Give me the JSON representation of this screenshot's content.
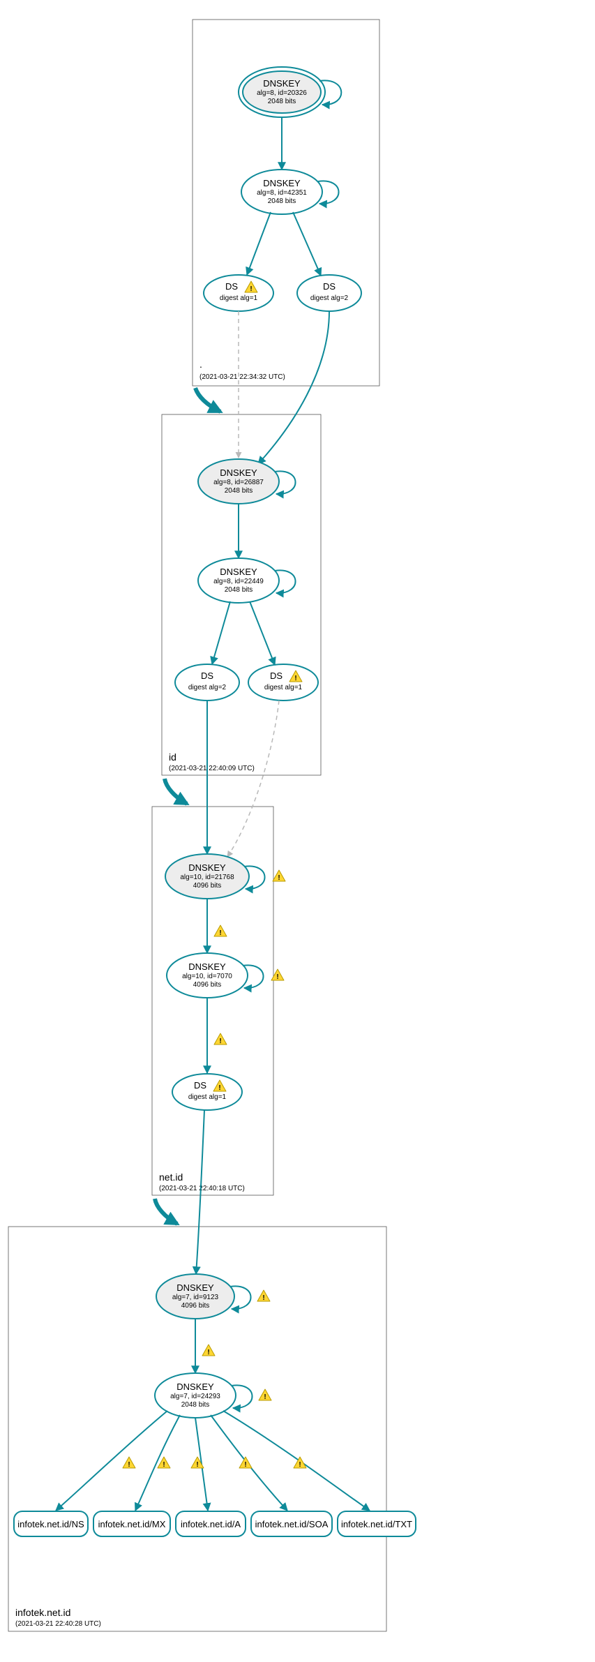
{
  "zones": {
    "root": {
      "label": ".",
      "timestamp": "(2021-03-21 22:34:32 UTC)"
    },
    "id": {
      "label": "id",
      "timestamp": "(2021-03-21 22:40:09 UTC)"
    },
    "netid": {
      "label": "net.id",
      "timestamp": "(2021-03-21 22:40:18 UTC)"
    },
    "target": {
      "label": "infotek.net.id",
      "timestamp": "(2021-03-21 22:40:28 UTC)"
    }
  },
  "nodes": {
    "root_ksk": {
      "title": "DNSKEY",
      "alg": "alg=8, id=20326",
      "bits": "2048 bits"
    },
    "root_zsk": {
      "title": "DNSKEY",
      "alg": "alg=8, id=42351",
      "bits": "2048 bits"
    },
    "root_ds1": {
      "title": "DS",
      "sub": "digest alg=1"
    },
    "root_ds2": {
      "title": "DS",
      "sub": "digest alg=2"
    },
    "id_ksk": {
      "title": "DNSKEY",
      "alg": "alg=8, id=26887",
      "bits": "2048 bits"
    },
    "id_zsk": {
      "title": "DNSKEY",
      "alg": "alg=8, id=22449",
      "bits": "2048 bits"
    },
    "id_ds2": {
      "title": "DS",
      "sub": "digest alg=2"
    },
    "id_ds1": {
      "title": "DS",
      "sub": "digest alg=1"
    },
    "netid_ksk": {
      "title": "DNSKEY",
      "alg": "alg=10, id=21768",
      "bits": "4096 bits"
    },
    "netid_zsk": {
      "title": "DNSKEY",
      "alg": "alg=10, id=7070",
      "bits": "4096 bits"
    },
    "netid_ds1": {
      "title": "DS",
      "sub": "digest alg=1"
    },
    "target_ksk": {
      "title": "DNSKEY",
      "alg": "alg=7, id=9123",
      "bits": "4096 bits"
    },
    "target_zsk": {
      "title": "DNSKEY",
      "alg": "alg=7, id=24293",
      "bits": "2048 bits"
    }
  },
  "rrsets": {
    "ns": "infotek.net.id/NS",
    "mx": "infotek.net.id/MX",
    "a": "infotek.net.id/A",
    "soa": "infotek.net.id/SOA",
    "txt": "infotek.net.id/TXT"
  }
}
